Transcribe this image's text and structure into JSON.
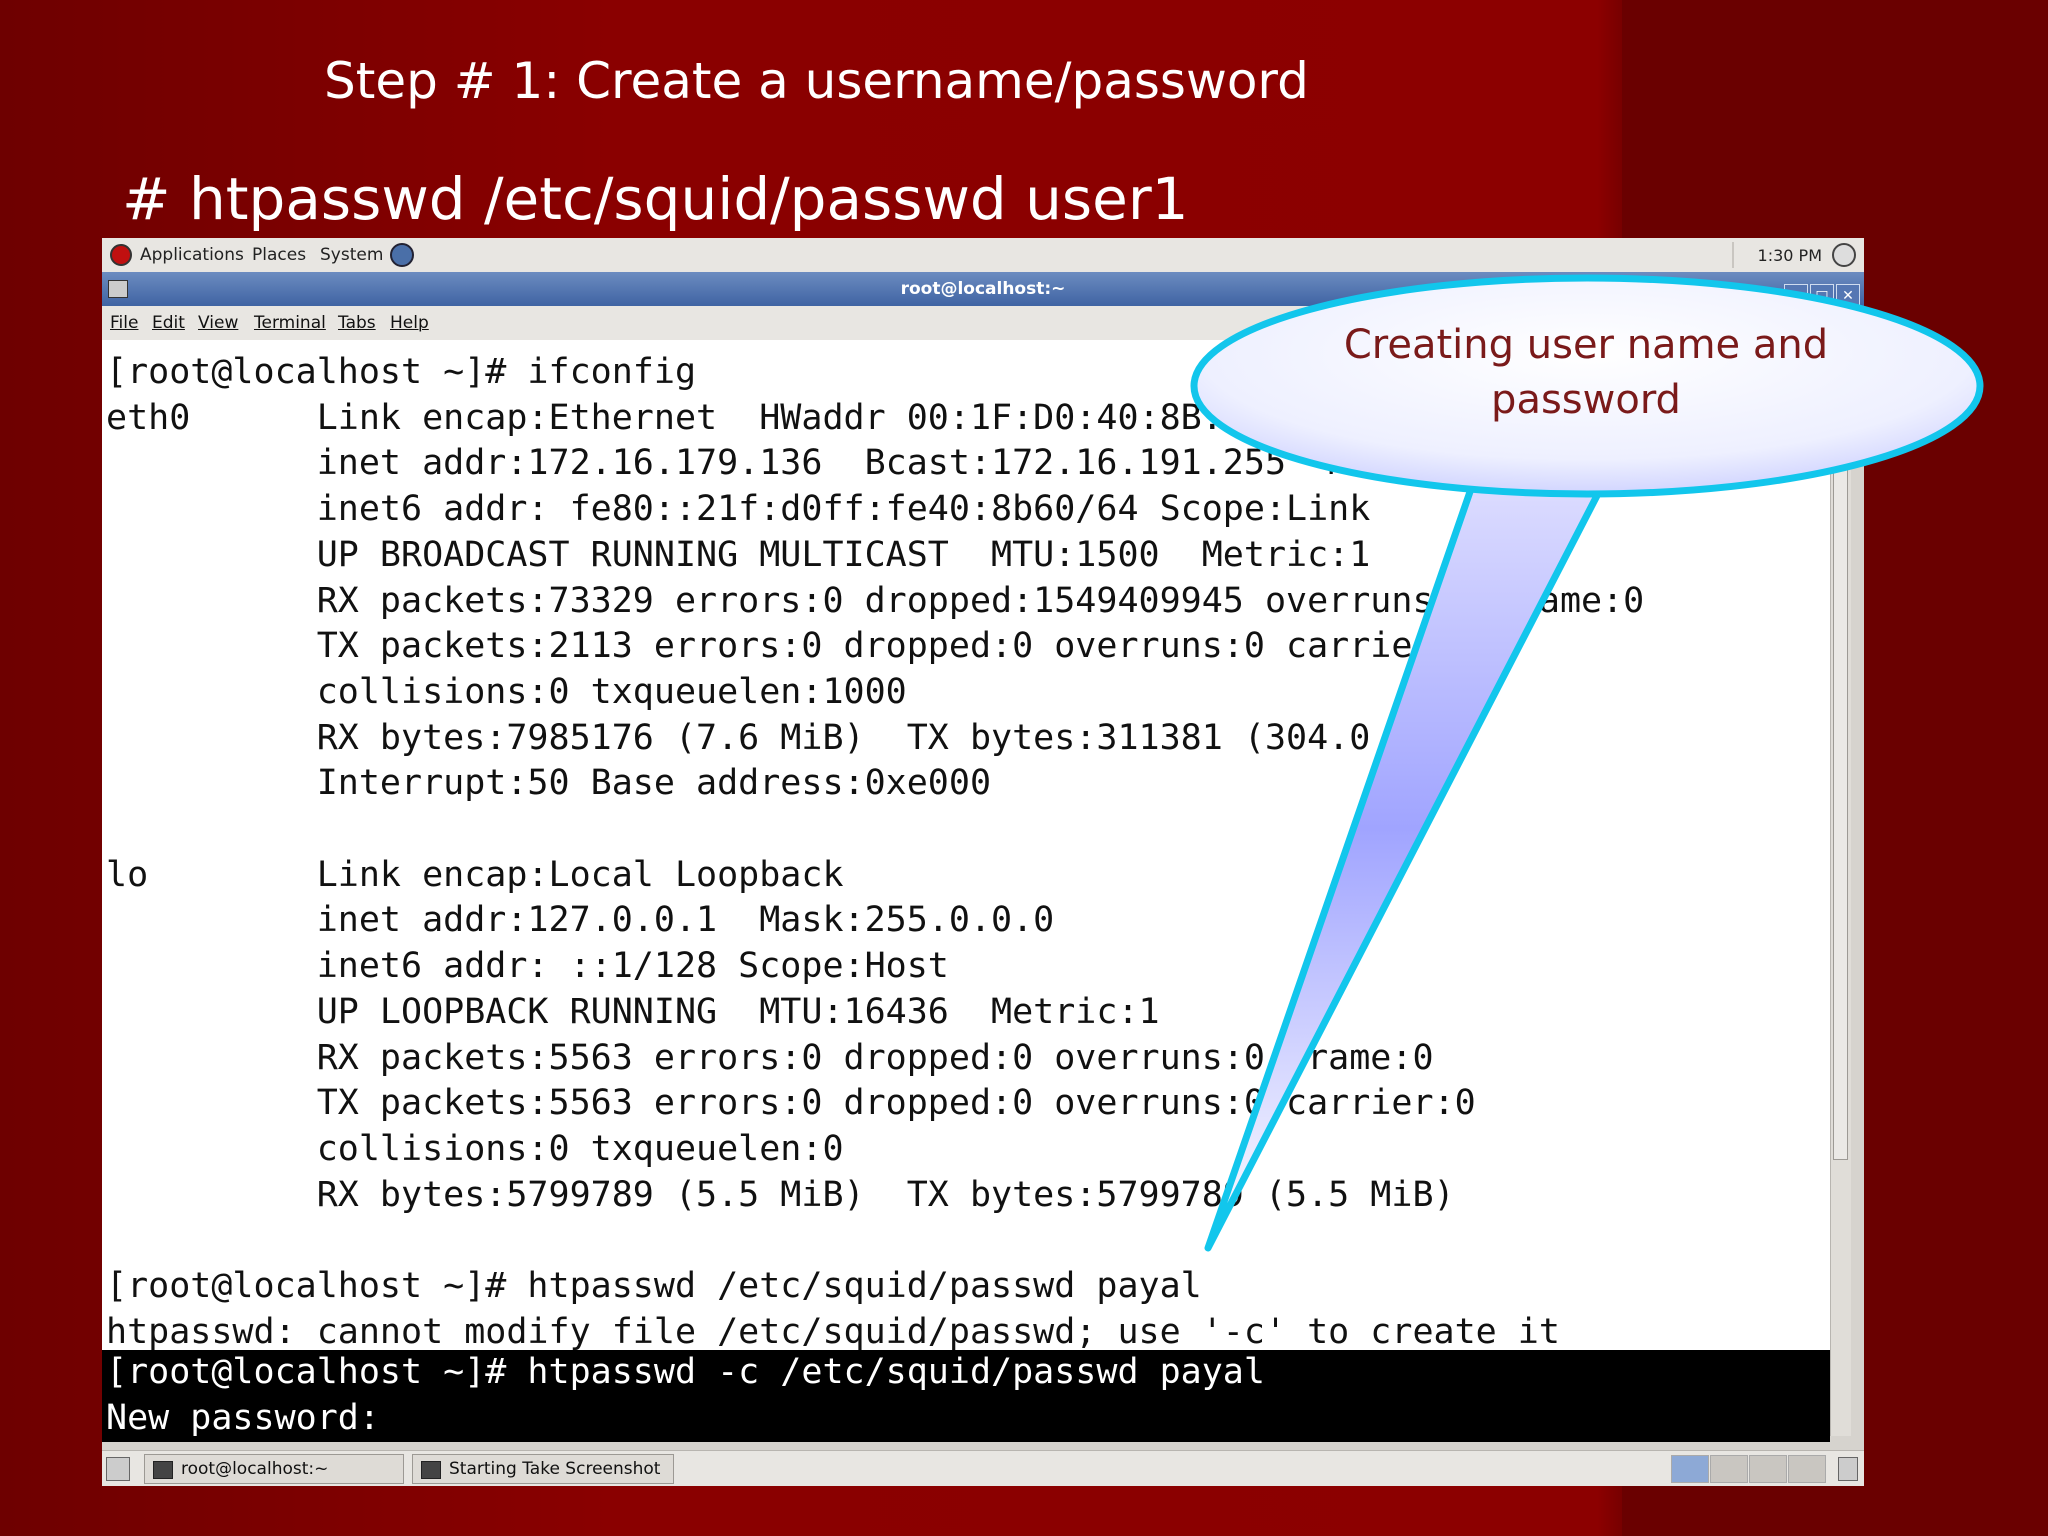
{
  "slide": {
    "title": "Step # 1: Create a username/password",
    "command": "# htpasswd /etc/squid/passwd user1"
  },
  "top_panel": {
    "applications": "Applications",
    "places": "Places",
    "system": "System",
    "clock": "1:30 PM"
  },
  "window": {
    "title": "root@localhost:~"
  },
  "menu": {
    "file": "File",
    "edit": "Edit",
    "view": "View",
    "terminal": "Terminal",
    "tabs": "Tabs",
    "help": "Help"
  },
  "terminal": {
    "output": "[root@localhost ~]# ifconfig\neth0      Link encap:Ethernet  HWaddr 00:1F:D0:40:8B:60\n          inet addr:172.16.179.136  Bcast:172.16.191.255  Mask:255.255.240.0\n          inet6 addr: fe80::21f:d0ff:fe40:8b60/64 Scope:Link\n          UP BROADCAST RUNNING MULTICAST  MTU:1500  Metric:1\n          RX packets:73329 errors:0 dropped:1549409945 overruns:0 frame:0\n          TX packets:2113 errors:0 dropped:0 overruns:0 carrier:0\n          collisions:0 txqueuelen:1000\n          RX bytes:7985176 (7.6 MiB)  TX bytes:311381 (304.0 KiB)\n          Interrupt:50 Base address:0xe000\n\nlo        Link encap:Local Loopback\n          inet addr:127.0.0.1  Mask:255.0.0.0\n          inet6 addr: ::1/128 Scope:Host\n          UP LOOPBACK RUNNING  MTU:16436  Metric:1\n          RX packets:5563 errors:0 dropped:0 overruns:0 frame:0\n          TX packets:5563 errors:0 dropped:0 overruns:0 carrier:0\n          collisions:0 txqueuelen:0\n          RX bytes:5799789 (5.5 MiB)  TX bytes:5799789 (5.5 MiB)\n\n[root@localhost ~]# htpasswd /etc/squid/passwd payal\nhtpasswd: cannot modify file /etc/squid/passwd; use '-c' to create it",
    "highlighted": "[root@localhost ~]# htpasswd -c /etc/squid/passwd payal\nNew password:"
  },
  "taskbar": {
    "task1": "root@localhost:~",
    "task2": "Starting Take Screenshot"
  },
  "callout": {
    "text": "Creating user name and password"
  },
  "colors": {
    "slide_background": "#8a0000",
    "callout_border": "#12c6ec",
    "callout_text": "#7a1a1a"
  }
}
